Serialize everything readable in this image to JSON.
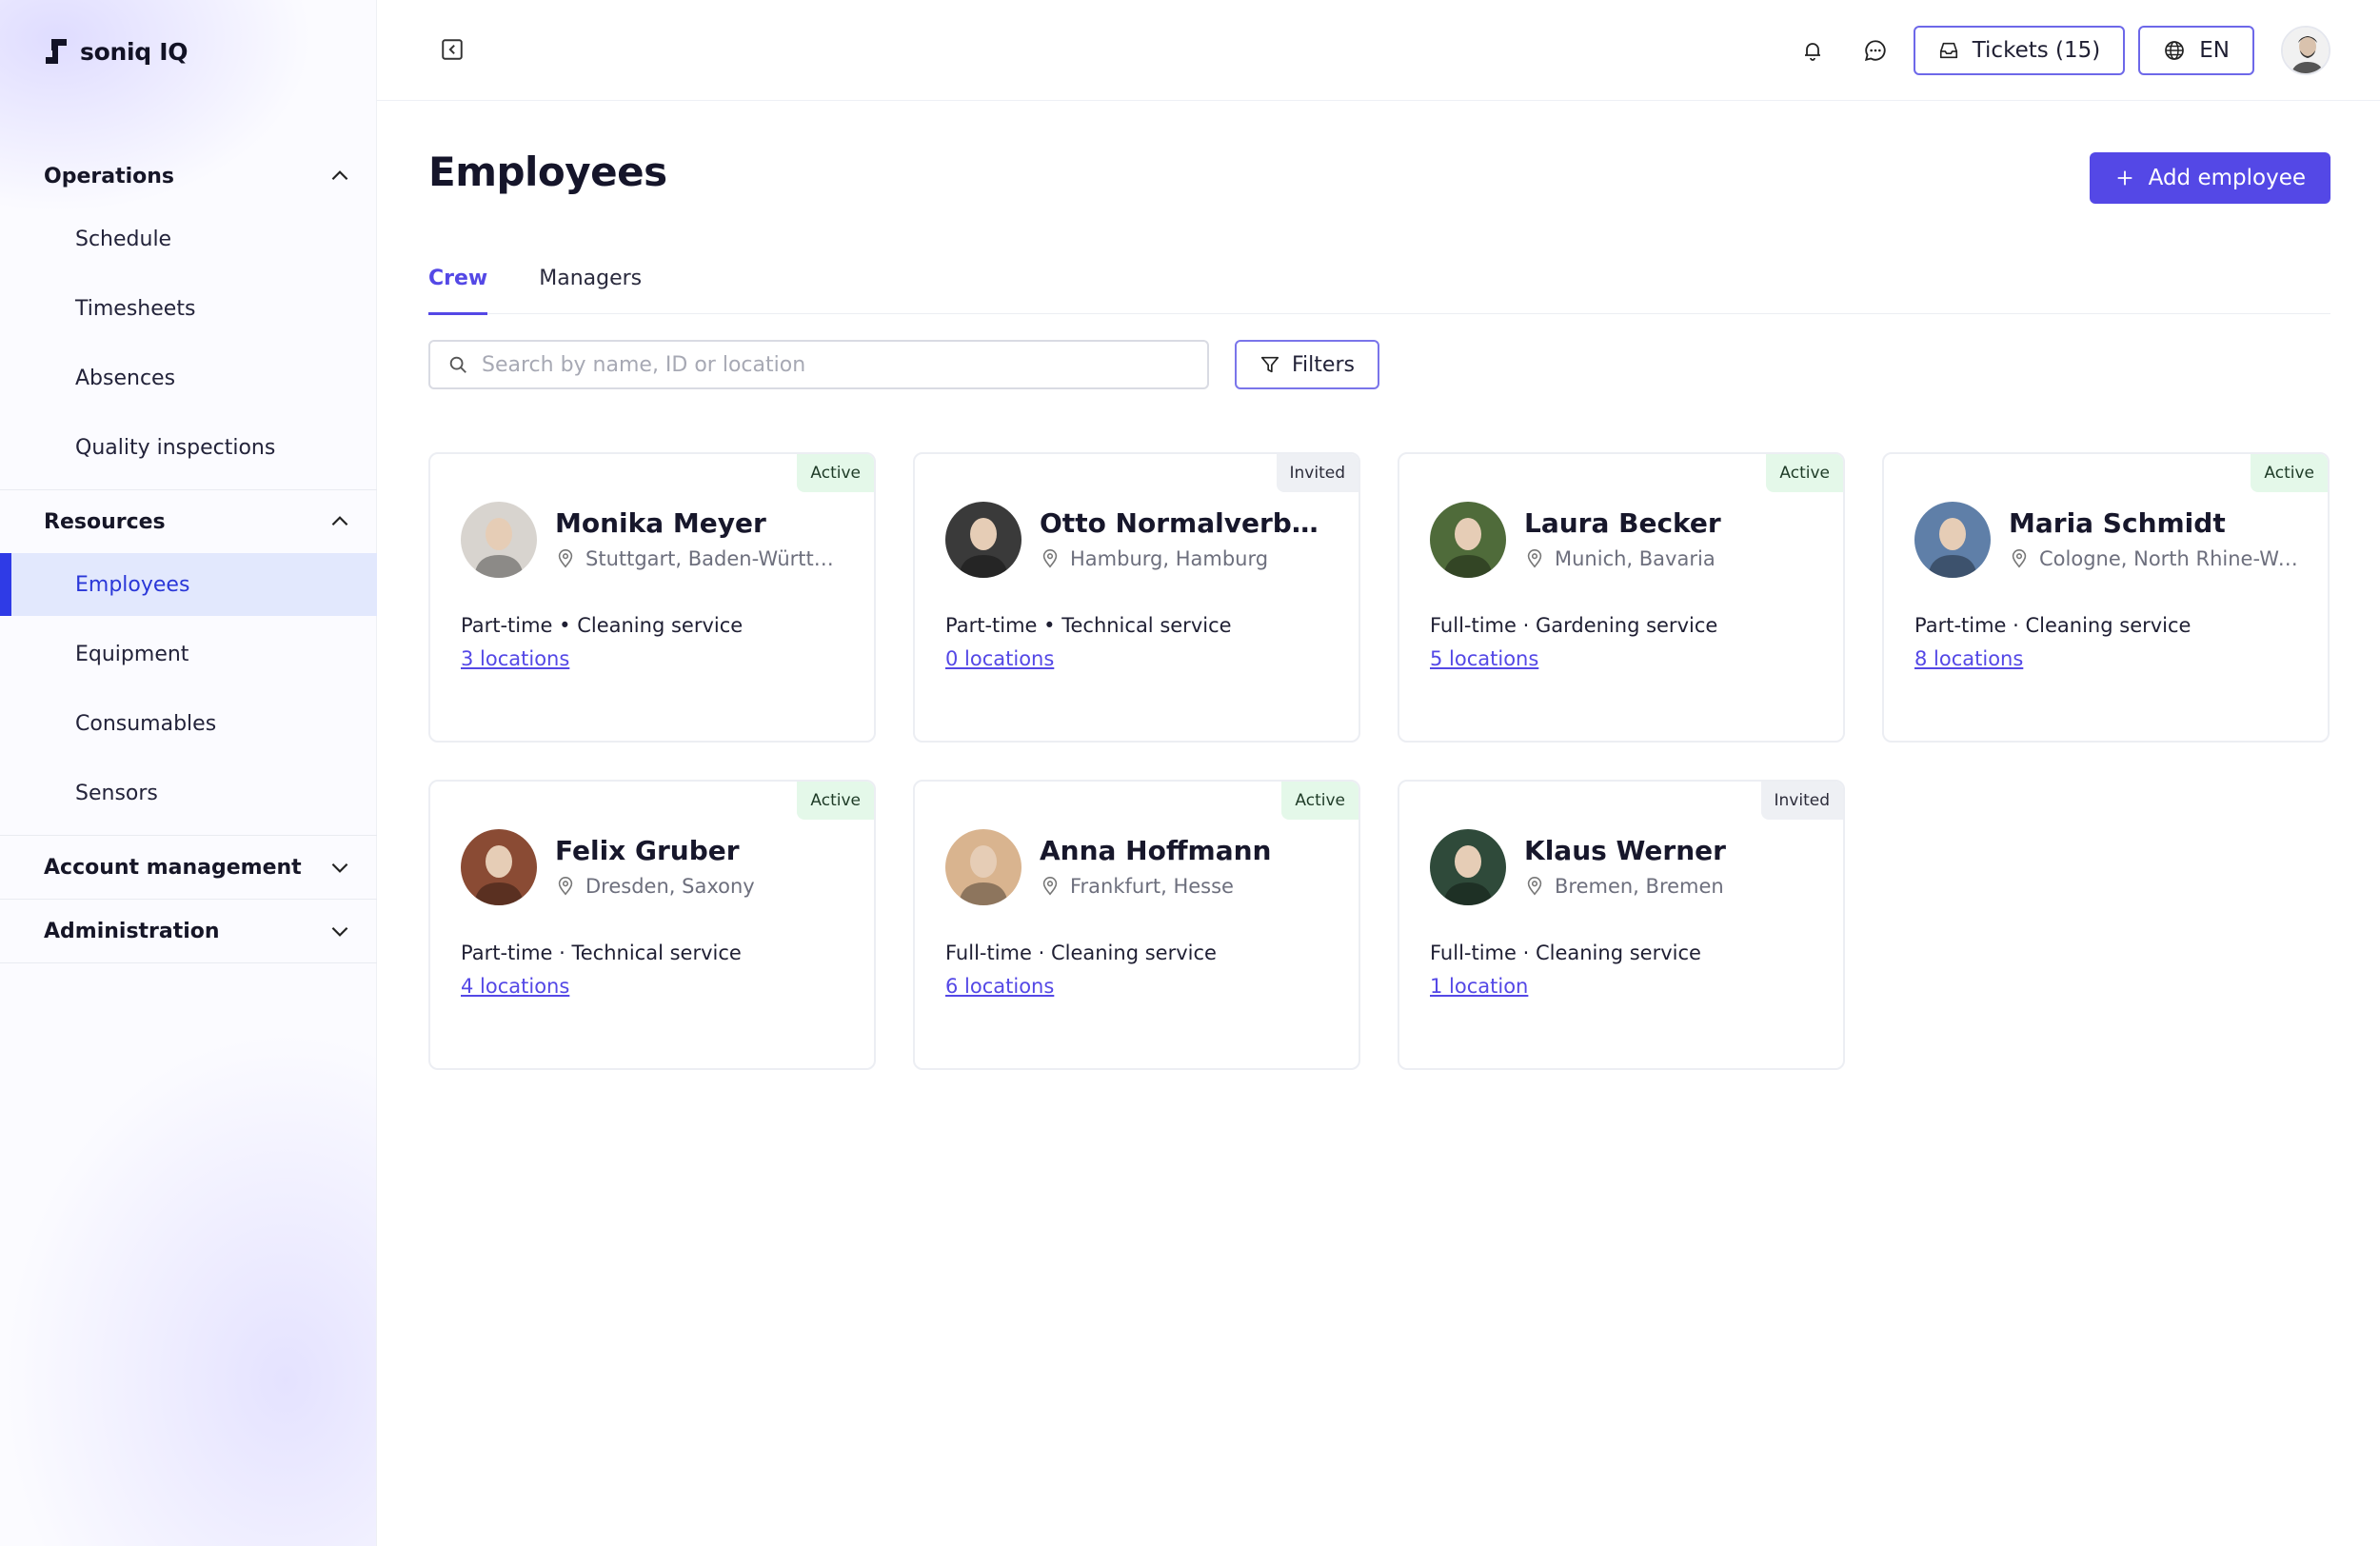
{
  "app": {
    "name": "soniq IQ"
  },
  "sidebar": {
    "groups": [
      {
        "label": "Operations",
        "expanded": true,
        "items": [
          "Schedule",
          "Timesheets",
          "Absences",
          "Quality inspections"
        ]
      },
      {
        "label": "Resources",
        "expanded": true,
        "items": [
          "Employees",
          "Equipment",
          "Consumables",
          "Sensors"
        ],
        "active": "Employees"
      },
      {
        "label": "Account management",
        "expanded": false,
        "items": []
      },
      {
        "label": "Administration",
        "expanded": false,
        "items": []
      }
    ]
  },
  "topbar": {
    "tickets_label": "Tickets (15)",
    "language_label": "EN"
  },
  "page": {
    "title": "Employees",
    "add_button": "Add employee",
    "tabs": [
      {
        "label": "Crew",
        "active": true
      },
      {
        "label": "Managers",
        "active": false
      }
    ],
    "search_placeholder": "Search by name, ID or location",
    "filters_label": "Filters"
  },
  "employees": [
    {
      "name": "Monika Meyer",
      "location": "Stuttgart, Baden-Württemberg",
      "status": "Active",
      "type": "Part-time • Cleaning service",
      "locations": "3 locations",
      "avatar_color": "#d8d4cf"
    },
    {
      "name": "Otto Normalverbraucher",
      "location": "Hamburg, Hamburg",
      "status": "Invited",
      "type": "Part-time • Technical service",
      "locations": "0 locations",
      "avatar_color": "#3a3a3a"
    },
    {
      "name": "Laura Becker",
      "location": "Munich, Bavaria",
      "status": "Active",
      "type": "Full-time · Gardening service",
      "locations": "5 locations",
      "avatar_color": "#4f6b3a"
    },
    {
      "name": "Maria Schmidt",
      "location": "Cologne, North Rhine-Westphalia",
      "status": "Active",
      "type": "Part-time · Cleaning service",
      "locations": "8 locations",
      "avatar_color": "#5f7fa8"
    },
    {
      "name": "Felix Gruber",
      "location": "Dresden, Saxony",
      "status": "Active",
      "type": "Part-time · Technical service",
      "locations": "4 locations",
      "avatar_color": "#8a4b34"
    },
    {
      "name": "Anna Hoffmann",
      "location": "Frankfurt, Hesse",
      "status": "Active",
      "type": "Full-time · Cleaning service",
      "locations": "6 locations",
      "avatar_color": "#d9b48f"
    },
    {
      "name": "Klaus Werner",
      "location": "Bremen, Bremen",
      "status": "Invited",
      "type": "Full-time · Cleaning service",
      "locations": "1 location",
      "avatar_color": "#2f4a3a"
    }
  ],
  "colors": {
    "accent": "#5448e6",
    "active_badge": "#e4f8e9",
    "invited_badge": "#eef0f4"
  }
}
